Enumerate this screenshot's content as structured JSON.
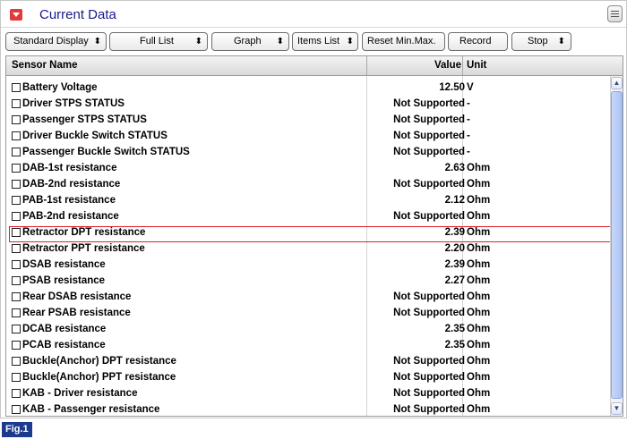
{
  "window": {
    "title": "Current Data",
    "title_icon": "collapse-arrow-icon",
    "menu_icon": "menu-list-icon",
    "accent_color": "#e23a3a"
  },
  "toolbar": {
    "standard_display": "Standard Display",
    "full_list": "Full List",
    "graph": "Graph",
    "items_list": "Items List",
    "reset_min_max": "Reset Min.Max.",
    "record": "Record",
    "stop": "Stop",
    "dropdown_glyph": "⬍"
  },
  "table": {
    "headers": {
      "sensor": "Sensor Name",
      "value": "Value",
      "unit": "Unit"
    },
    "rows": [
      {
        "name": "Battery Voltage",
        "value": "12.50",
        "unit": "V"
      },
      {
        "name": "Driver STPS STATUS",
        "value": "Not Supported",
        "unit": "-"
      },
      {
        "name": "Passenger STPS STATUS",
        "value": "Not Supported",
        "unit": "-"
      },
      {
        "name": "Driver Buckle Switch STATUS",
        "value": "Not Supported",
        "unit": "-"
      },
      {
        "name": "Passenger Buckle Switch STATUS",
        "value": "Not Supported",
        "unit": "-"
      },
      {
        "name": "DAB-1st resistance",
        "value": "2.63",
        "unit": "Ohm"
      },
      {
        "name": "DAB-2nd resistance",
        "value": "Not Supported",
        "unit": "Ohm"
      },
      {
        "name": "PAB-1st resistance",
        "value": "2.12",
        "unit": "Ohm"
      },
      {
        "name": "PAB-2nd resistance",
        "value": "Not Supported",
        "unit": "Ohm"
      },
      {
        "name": "Retractor DPT resistance",
        "value": "2.39",
        "unit": "Ohm"
      },
      {
        "name": "Retractor PPT resistance",
        "value": "2.20",
        "unit": "Ohm"
      },
      {
        "name": "DSAB resistance",
        "value": "2.39",
        "unit": "Ohm"
      },
      {
        "name": "PSAB resistance",
        "value": "2.27",
        "unit": "Ohm"
      },
      {
        "name": "Rear DSAB resistance",
        "value": "Not Supported",
        "unit": "Ohm"
      },
      {
        "name": "Rear PSAB resistance",
        "value": "Not Supported",
        "unit": "Ohm"
      },
      {
        "name": "DCAB resistance",
        "value": "2.35",
        "unit": "Ohm"
      },
      {
        "name": "PCAB resistance",
        "value": "2.35",
        "unit": "Ohm"
      },
      {
        "name": "Buckle(Anchor) DPT resistance",
        "value": "Not Supported",
        "unit": "Ohm"
      },
      {
        "name": "Buckle(Anchor) PPT resistance",
        "value": "Not Supported",
        "unit": "Ohm"
      },
      {
        "name": "KAB - Driver resistance",
        "value": "Not Supported",
        "unit": "Ohm"
      },
      {
        "name": "KAB - Passenger resistance",
        "value": "Not Supported",
        "unit": "Ohm"
      }
    ],
    "highlighted_row": "Retractor DPT resistance",
    "highlight_color": "#e0202a"
  },
  "scrollbar": {
    "up_glyph": "▲",
    "down_glyph": "▼"
  },
  "caption": "Fig.1"
}
